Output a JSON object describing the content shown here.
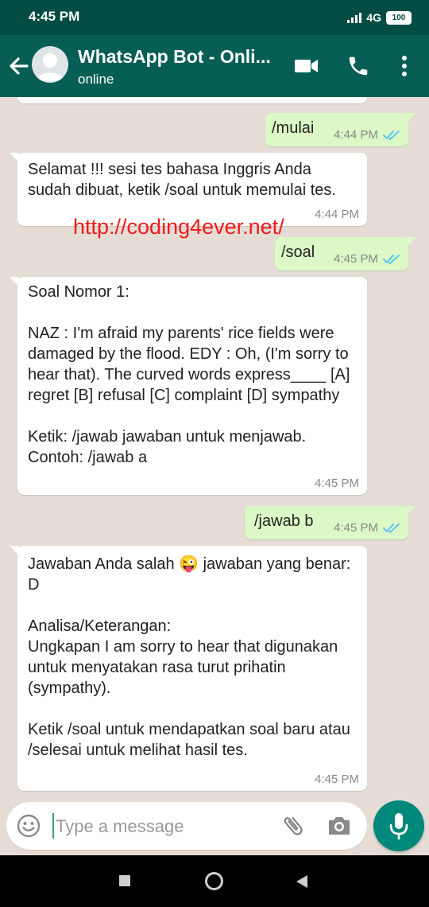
{
  "status_bar": {
    "time": "4:45 PM",
    "network": "4G",
    "battery": "100"
  },
  "header": {
    "title": "WhatsApp Bot - Onli...",
    "subtitle": "online"
  },
  "colors": {
    "header": "#075e54",
    "status_bar": "#054d44",
    "outgoing": "#dcf8c6",
    "incoming": "#ffffff",
    "accent": "#00897b",
    "tick_blue": "#4fc3f7"
  },
  "watermark": "http://coding4ever.net/",
  "messages": [
    {
      "dir": "out",
      "text": "/mulai",
      "time": "4:44 PM",
      "ticks": "read"
    },
    {
      "dir": "in",
      "text": "Selamat !!! sesi tes bahasa Inggris Anda sudah dibuat, ketik /soal untuk memulai tes.",
      "time": "4:44 PM"
    },
    {
      "dir": "out",
      "text": "/soal",
      "time": "4:45 PM",
      "ticks": "read"
    },
    {
      "dir": "in",
      "text": "Soal Nomor 1:\n\nNAZ : I'm afraid my parents' rice fields were damaged by the flood. EDY : Oh, (I'm sorry to hear that). The curved words express____ [A] regret [B] refusal [C] complaint [D] sympathy\n\nKetik: /jawab jawaban untuk menjawab.\nContoh: /jawab a",
      "time": "4:45 PM"
    },
    {
      "dir": "out",
      "text": "/jawab b",
      "time": "4:45 PM",
      "ticks": "read"
    },
    {
      "dir": "in",
      "text": "Jawaban Anda salah 😜 jawaban yang benar: D\n\nAnalisa/Keterangan:\nUngkapan I am sorry to hear that digunakan untuk menyatakan rasa turut prihatin (sympathy).\n\nKetik /soal untuk mendapatkan soal baru atau /selesai untuk melihat hasil tes.",
      "time": "4:45 PM"
    }
  ],
  "composer": {
    "placeholder": "Type a message"
  },
  "icons": {
    "back": "arrow-left-icon",
    "video": "video-camera-icon",
    "call": "phone-icon",
    "menu": "more-vertical-icon",
    "emoji": "smiley-icon",
    "attach": "paperclip-icon",
    "camera": "camera-icon",
    "mic": "microphone-icon"
  }
}
